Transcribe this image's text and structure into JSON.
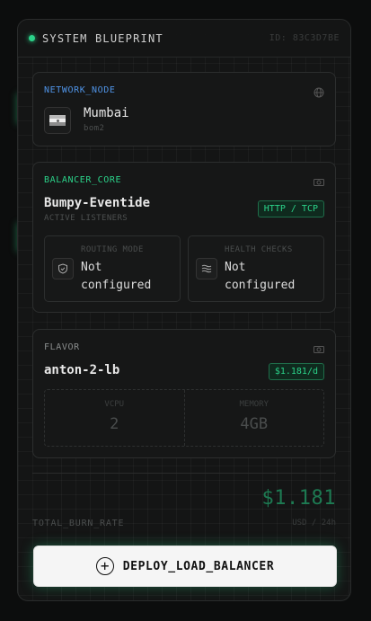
{
  "header": {
    "title": "SYSTEM BLUEPRINT",
    "id": "ID: 83C3D7BE"
  },
  "network_node": {
    "label": "NETWORK_NODE",
    "icon": "globe-icon",
    "flag": "india-flag",
    "city": "Mumbai",
    "code": "bom2"
  },
  "balancer_core": {
    "label": "BALANCER_CORE",
    "icon": "eye-icon",
    "name": "Bumpy-Eventide",
    "subtitle": "ACTIVE LISTENERS",
    "protocol_badge": "HTTP / TCP",
    "routing": {
      "label": "ROUTING MODE",
      "value": "Not configured",
      "icon": "shield-icon"
    },
    "health": {
      "label": "HEALTH CHECKS",
      "value": "Not configured",
      "icon": "waves-icon"
    }
  },
  "flavor": {
    "label": "FLAVOR",
    "icon": "eye-icon",
    "name": "anton-2-lb",
    "price": "$1.181/d",
    "vcpu": {
      "label": "VCPU",
      "value": "2"
    },
    "memory": {
      "label": "MEMORY",
      "value": "4GB"
    }
  },
  "burn_rate": {
    "label": "TOTAL_BURN_RATE",
    "value": "$1.181",
    "unit": "USD / 24h"
  },
  "deploy_button": {
    "label": "DEPLOY_LOAD_BALANCER",
    "icon": "plus-circle-icon"
  },
  "colors": {
    "accent": "#2bd38a",
    "network_label": "#4f93e6",
    "background": "#0c0d0d"
  }
}
